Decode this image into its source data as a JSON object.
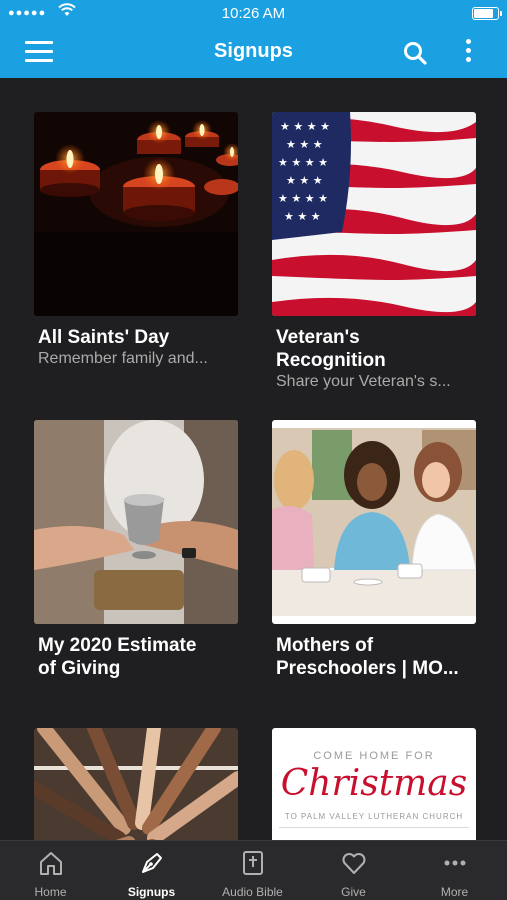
{
  "status_bar": {
    "time": "10:26 AM",
    "signal": "●●●●●",
    "wifi": "wifi-icon",
    "battery_level": 0.9
  },
  "app_bar": {
    "title": "Signups"
  },
  "cards": [
    {
      "title": "All Saints' Day",
      "subtitle": "Remember family and...",
      "image": "candles-photo"
    },
    {
      "title": "Veteran's\nRecognition",
      "subtitle": "Share your Veteran's s...",
      "image": "american-flag-photo"
    },
    {
      "title": "My 2020 Estimate\nof Giving",
      "subtitle": "",
      "image": "offering-plate-photo"
    },
    {
      "title": "Mothers of\nPreschoolers | MO...",
      "subtitle": "",
      "image": "women-coffee-photo"
    },
    {
      "title": "",
      "subtitle": "",
      "image": "stacked-hands-photo"
    },
    {
      "title": "",
      "subtitle": "",
      "image": "christmas-card",
      "card_text": {
        "line1": "COME HOME FOR",
        "line2": "Christmas",
        "line3": "TO PALM VALLEY LUTHERAN CHURCH"
      }
    }
  ],
  "tabs": [
    {
      "label": "Home",
      "icon": "home-icon"
    },
    {
      "label": "Signups",
      "icon": "pen-icon",
      "active": true
    },
    {
      "label": "Audio Bible",
      "icon": "bible-icon"
    },
    {
      "label": "Give",
      "icon": "heart-icon"
    },
    {
      "label": "More",
      "icon": "more-dots-icon"
    }
  ],
  "colors": {
    "accent": "#1ba1e2",
    "background": "#1f1f21",
    "tabbar": "#2a2a2c"
  }
}
